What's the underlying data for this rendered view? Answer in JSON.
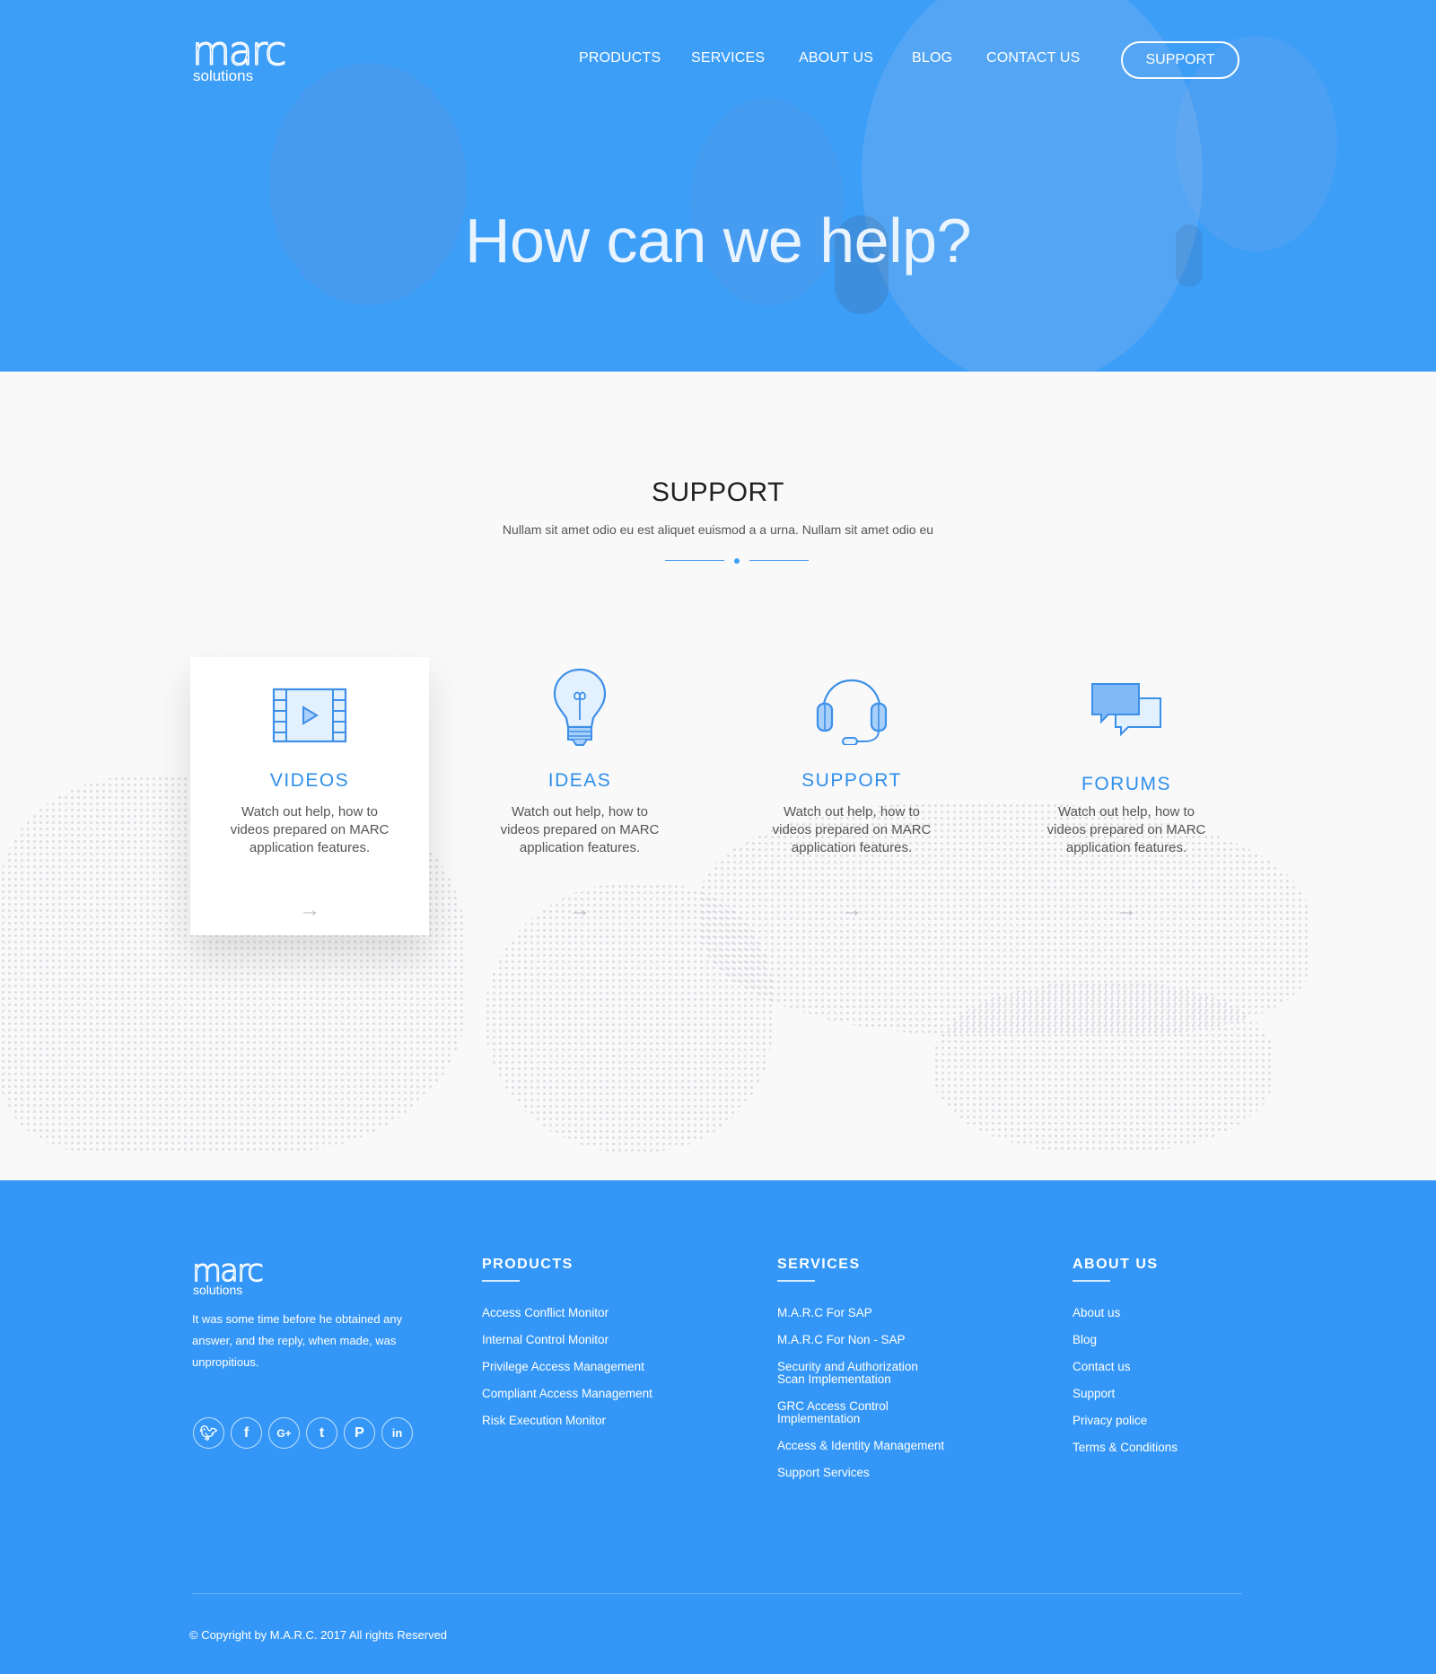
{
  "header": {
    "logo_mark": "marc",
    "logo_sub": "solutions",
    "nav": [
      "PRODUCTS",
      "SERVICES",
      "ABOUT US",
      "BLOG",
      "CONTACT US"
    ],
    "support_button": "SUPPORT",
    "hero_title": "How can we help?"
  },
  "support": {
    "heading": "SUPPORT",
    "lead": "Nullam sit amet odio eu est aliquet euismod a a urna. Nullam sit amet odio eu",
    "cards": [
      {
        "title": "VIDEOS",
        "desc": "Watch out help, how to videos prepared on MARC application features.",
        "icon": "video-icon",
        "arrow": "→"
      },
      {
        "title": "IDEAS",
        "desc": "Watch out help, how to videos prepared on MARC application features.",
        "icon": "lightbulb-icon",
        "arrow": "→"
      },
      {
        "title": "SUPPORT",
        "desc": "Watch out help, how to videos prepared on MARC application features.",
        "icon": "headset-icon",
        "arrow": "→"
      },
      {
        "title": "FORUMS",
        "desc": "Watch out help, how to videos prepared on MARC application features.",
        "icon": "chat-bubbles-icon",
        "arrow": "→"
      }
    ]
  },
  "footer": {
    "logo_mark": "marc",
    "logo_sub": "solutions",
    "about_text": "It was some time before he obtained any answer, and the reply, when made, was unpropitious.",
    "social": [
      {
        "icon": "twitter-icon",
        "glyph": "🐦"
      },
      {
        "icon": "facebook-icon",
        "glyph": "f"
      },
      {
        "icon": "google-plus-icon",
        "glyph": "G+"
      },
      {
        "icon": "tumblr-icon",
        "glyph": "t"
      },
      {
        "icon": "pinterest-icon",
        "glyph": "P"
      },
      {
        "icon": "linkedin-icon",
        "glyph": "in"
      }
    ],
    "products": {
      "heading": "PRODUCTS",
      "links": [
        "Access Conflict Monitor",
        "Internal Control Monitor",
        "Privilege Access Management",
        "Compliant Access Management",
        "Risk Execution Monitor"
      ]
    },
    "services": {
      "heading": "SERVICES",
      "links": [
        "M.A.R.C For SAP",
        "M.A.R.C For Non - SAP",
        "Security and Authorization Scan Implementation",
        "GRC Access Control Implementation",
        "Access & Identity Management",
        "Support Services"
      ]
    },
    "about": {
      "heading": "ABOUT US",
      "links": [
        "About us",
        "Blog",
        "Contact us",
        "Support",
        "Privacy police",
        "Terms & Conditions"
      ]
    },
    "copyright": "© Copyright by M.A.R.C. 2017 All rights Reserved"
  },
  "colors": {
    "primary": "#3d9ef8",
    "footer": "#3497f7",
    "accent_text": "#2f8fea"
  }
}
